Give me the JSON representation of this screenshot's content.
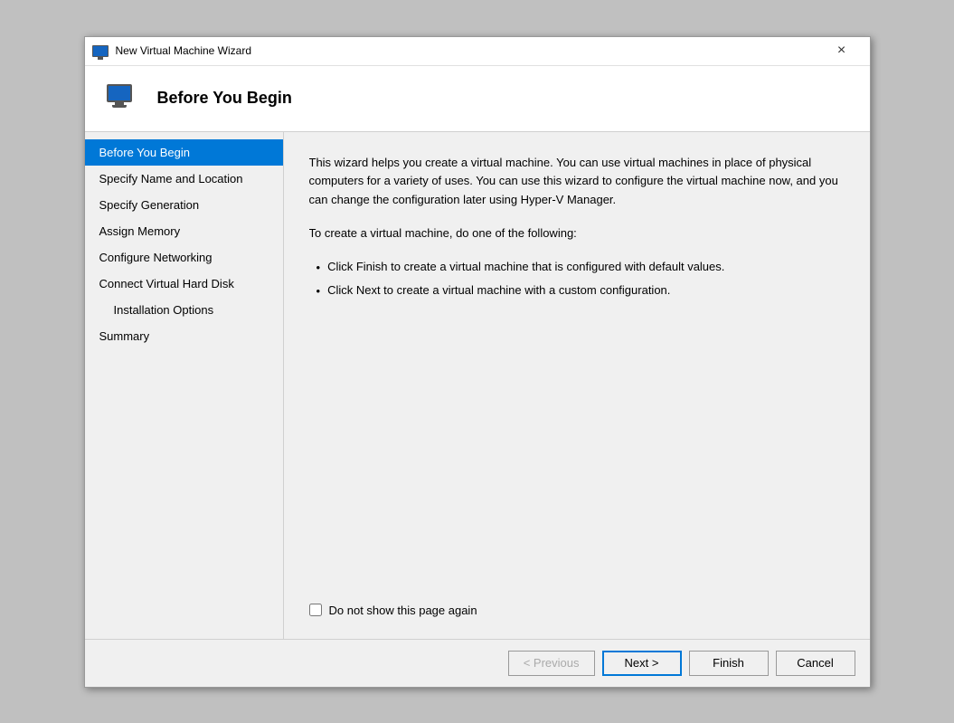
{
  "window": {
    "title": "New Virtual Machine Wizard",
    "close_label": "×"
  },
  "header": {
    "title": "Before You Begin",
    "icon_alt": "virtual machine icon"
  },
  "sidebar": {
    "items": [
      {
        "id": "before-you-begin",
        "label": "Before You Begin",
        "active": true,
        "sub": false
      },
      {
        "id": "specify-name",
        "label": "Specify Name and Location",
        "active": false,
        "sub": false
      },
      {
        "id": "specify-generation",
        "label": "Specify Generation",
        "active": false,
        "sub": false
      },
      {
        "id": "assign-memory",
        "label": "Assign Memory",
        "active": false,
        "sub": false
      },
      {
        "id": "configure-networking",
        "label": "Configure Networking",
        "active": false,
        "sub": false
      },
      {
        "id": "connect-vhd",
        "label": "Connect Virtual Hard Disk",
        "active": false,
        "sub": false
      },
      {
        "id": "installation-options",
        "label": "Installation Options",
        "active": false,
        "sub": true
      },
      {
        "id": "summary",
        "label": "Summary",
        "active": false,
        "sub": false
      }
    ]
  },
  "main": {
    "paragraph1": "This wizard helps you create a virtual machine. You can use virtual machines in place of physical computers for a variety of uses. You can use this wizard to configure the virtual machine now, and you can change the configuration later using Hyper-V Manager.",
    "paragraph2": "To create a virtual machine, do one of the following:",
    "bullets": [
      "Click Finish to create a virtual machine that is configured with default values.",
      "Click Next to create a virtual machine with a custom configuration."
    ],
    "checkbox_label": "Do not show this page again"
  },
  "footer": {
    "previous_label": "< Previous",
    "next_label": "Next >",
    "finish_label": "Finish",
    "cancel_label": "Cancel"
  }
}
